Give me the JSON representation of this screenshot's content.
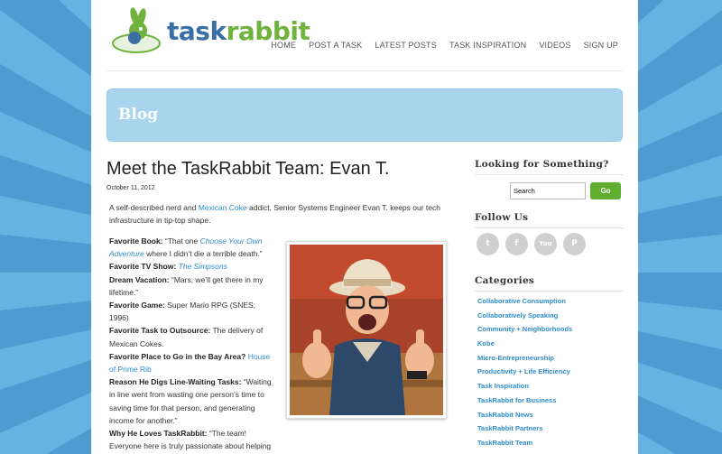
{
  "brand": {
    "logo_part1": "task",
    "logo_part2": "rabbit"
  },
  "nav": [
    "HOME",
    "POST A TASK",
    "LATEST POSTS",
    "TASK INSPIRATION",
    "VIDEOS",
    "SIGN UP"
  ],
  "banner": {
    "title": "Blog"
  },
  "post": {
    "title": "Meet the TaskRabbit Team: Evan T.",
    "date": "October 11, 2012",
    "intro_pre": "A self-described nerd and ",
    "intro_link": "Mexican Coke",
    "intro_post": " addict, Senior Systems Engineer Evan T. keeps our tech infrastructure in tip-top shape.",
    "facts": [
      {
        "label": "Favorite Book:",
        "pre": " “That one ",
        "link": "Choose Your Own Adventure",
        "post": " where I didn’t die a terrible death.”"
      },
      {
        "label": "Favorite TV Show:",
        "pre": " ",
        "link": "The Simpsons",
        "post": ""
      },
      {
        "label": "Dream Vacation:",
        "pre": " “Mars, we’ll get there in my lifetime.”",
        "link": "",
        "post": ""
      },
      {
        "label": "Favorite Game:",
        "pre": " Super Mario RPG (SNES; 1996)",
        "link": "",
        "post": ""
      },
      {
        "label": "Favorite Task to Outsource:",
        "pre": " The delivery of Mexican Cokes.",
        "link": "",
        "post": ""
      },
      {
        "label": "Favorite Place to Go in the Bay Area?",
        "pre": " ",
        "link": "House of Prime Rib",
        "post": ""
      },
      {
        "label": "Reason He Digs Line-Waiting Tasks:",
        "pre": " “Waiting in line went from wasting one person’s time to saving time for that person, and generating income for another.”",
        "link": "",
        "post": ""
      },
      {
        "label": "Why He Loves TaskRabbit:",
        "pre": " “The team! Everyone here is truly passionate about helping people get things done.”",
        "link": "",
        "post": ""
      }
    ]
  },
  "sidebar": {
    "search_heading": "Looking for Something?",
    "search_value": "Search",
    "search_button": "Go",
    "follow_heading": "Follow Us",
    "social": [
      {
        "icon": "twitter-icon",
        "glyph": "t"
      },
      {
        "icon": "facebook-icon",
        "glyph": "f"
      },
      {
        "icon": "youtube-icon",
        "glyph": "You"
      },
      {
        "icon": "pinterest-icon",
        "glyph": "P"
      }
    ],
    "categories_heading": "Categories",
    "categories": [
      "Collaborative Consumption",
      "Collaboratively Speaking",
      "Community + Neighborhoods",
      "Kobe",
      "Micro-Entrepreneurship",
      "Productivity + Life Efficiency",
      "Task Inspiration",
      "TaskRabbit for Business",
      "TaskRabbit News",
      "TaskRabbit Partners",
      "TaskRabbit Team"
    ]
  },
  "colors": {
    "accent": "#2e8bc9",
    "green": "#5fae2f",
    "banner": "#a9d4ee"
  }
}
